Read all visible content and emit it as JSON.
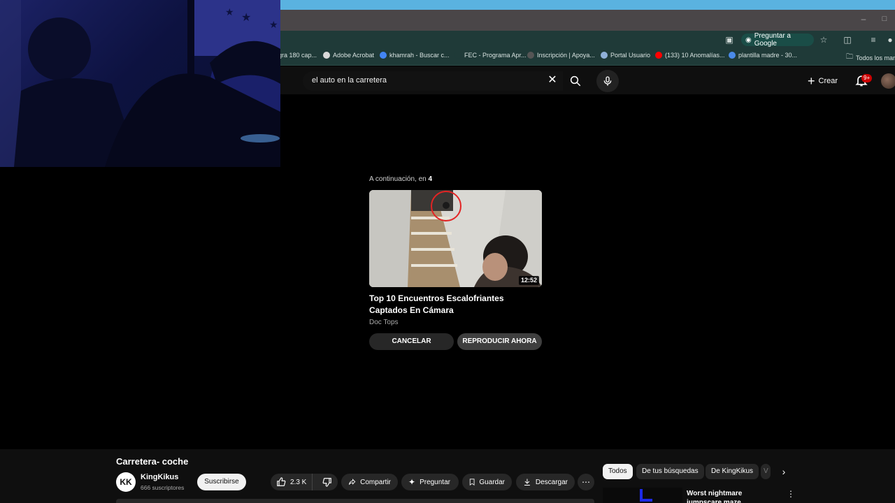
{
  "browser": {
    "ask_google_label": "Preguntar a Google",
    "bookmarks": [
      {
        "label": "gra 180 cap...",
        "color": "#e2e2e2"
      },
      {
        "label": "Adobe Acrobat",
        "color": "#d9d9d9"
      },
      {
        "label": "khamrah - Buscar c...",
        "color": "#4285f4"
      },
      {
        "label": "FEC - Programa Apr...",
        "color": "#1f3a38"
      },
      {
        "label": "Inscripción | Apoya...",
        "color": "#555555"
      },
      {
        "label": "Portal Usuario",
        "color": "#8fb0d8"
      },
      {
        "label": "(133) 10 Anomalías...",
        "color": "#ff0000"
      },
      {
        "label": "plantilla madre - 30...",
        "color": "#4a8ae8"
      },
      {
        "label": "Todos los marc",
        "color": "#d0d0d0"
      }
    ]
  },
  "header": {
    "search_value": "el auto en la carretera",
    "create_label": "Crear",
    "notification_count": "9+"
  },
  "end_screen": {
    "next_prefix": "A continuación, en ",
    "next_seconds": "4",
    "duration": "12:52",
    "title": "Top 10 Encuentros Escalofriantes Captados En Cámara",
    "channel": "Doc Tops",
    "cancel_label": "CANCELAR",
    "play_now_label": "REPRODUCIR AHORA"
  },
  "video": {
    "title": "Carretera- coche",
    "channel_name": "KingKikus",
    "channel_avatar_text": "KK",
    "subscribers": "666 suscriptores",
    "subscribe_label": "Suscribirse",
    "likes": "2.3 K",
    "share_label": "Compartir",
    "ask_label": "Preguntar",
    "save_label": "Guardar",
    "download_label": "Descargar"
  },
  "recommendations": {
    "chips": [
      "Todos",
      "De tus búsquedas",
      "De KingKikus",
      "V"
    ],
    "first_title": "Worst nightmare jumpscare maze"
  }
}
